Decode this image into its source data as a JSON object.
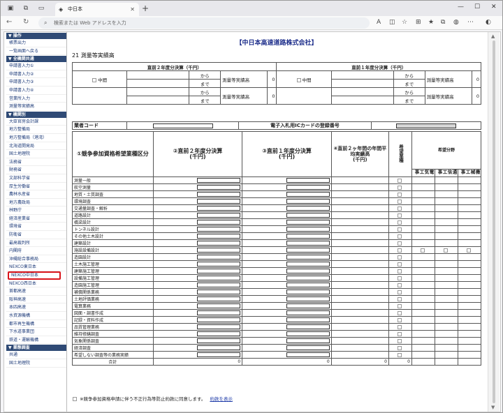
{
  "browser": {
    "tab_title": "中日本",
    "address_placeholder": "検索または Web アドレスを入力"
  },
  "sidebar": {
    "sections": [
      {
        "header": "▼ 操作",
        "items": [
          "帳票出力",
          "一覧画面へ戻る"
        ]
      },
      {
        "header": "▼ 全機関共通",
        "items": [
          "申請書入力①",
          "申請書入力②",
          "申請書入力③",
          "申請書入力④",
          "営業所入力",
          "測量等実績高"
        ]
      },
      {
        "header": "▼ 機関別",
        "items": [
          "大臣官房会計課",
          "地方整備局",
          "地方整備局（港湾）",
          "北海道開発局",
          "国土地理院",
          "法務省",
          "財務省",
          "文部科学省",
          "厚生労働省",
          "農林水産省",
          "地方農政局",
          "林野庁",
          "経済産業省",
          "環境省",
          "防衛省",
          "最高裁判所",
          "内閣府",
          "沖縄総合事務局",
          "NEXCO東日本",
          "NEXCO中日本",
          "NEXCO西日本",
          "首都高速",
          "阪神高速",
          "本四高速",
          "水資源機構",
          "都市再生機構",
          "下水道事業団",
          "鉄道・運輸機構"
        ]
      },
      {
        "header": "▼ 業態調査",
        "items": [
          "共通",
          "国土地理院"
        ]
      }
    ],
    "selected": "NEXCO中日本"
  },
  "main": {
    "company": "【中日本高速道路株式会社】",
    "section_title": "21 測量等実績高",
    "prev2_header": "直前２年度分決算（千円）",
    "prev1_header": "直前１年度分決算（千円）",
    "chukan": "中間",
    "kara": "から",
    "made": "まで",
    "jisseki": "測量等実績高",
    "zero": "0",
    "gyosha_code": "業者コード",
    "ic_card": "電子入札用ICカードの登録番号",
    "col1": "①競争参加資格希望業種区分",
    "col2": "②直前２年度分決算\n(千円)",
    "col3": "③直前１年度分決算\n(千円)",
    "col4": "④直前２ヶ年間の年間平均実績高\n(千円)",
    "col5": "希望業種",
    "col6": "希望分野",
    "sub_a": "電気工事",
    "sub_b": "通信工事",
    "sub_c": "機械工事",
    "rows": [
      "測量一般",
      "航空測量",
      "地質・土質調査",
      "環境調査",
      "交通量調査・解析",
      "道路設計",
      "橋梁設計",
      "トンネル設計",
      "その他土木設計",
      "建築設計",
      "施設設備設計",
      "造園設計",
      "土木施工管理",
      "建築施工管理",
      "設備施工管理",
      "造園施工管理",
      "補償関係業務",
      "土地評価業務",
      "電算業務",
      "図面・調書作成",
      "記録・資料作成",
      "品質管理業務",
      "維持修繕調査",
      "気象関係調査",
      "経済調査",
      "希望しない調査等の業務実績"
    ],
    "total_label": "合計",
    "total_values": [
      "0",
      "0",
      "0",
      "0"
    ],
    "agree_text": "※競争参加資格申請に伴う不正行為等防止約款に同意します。",
    "agree_link": "約款を表示"
  }
}
